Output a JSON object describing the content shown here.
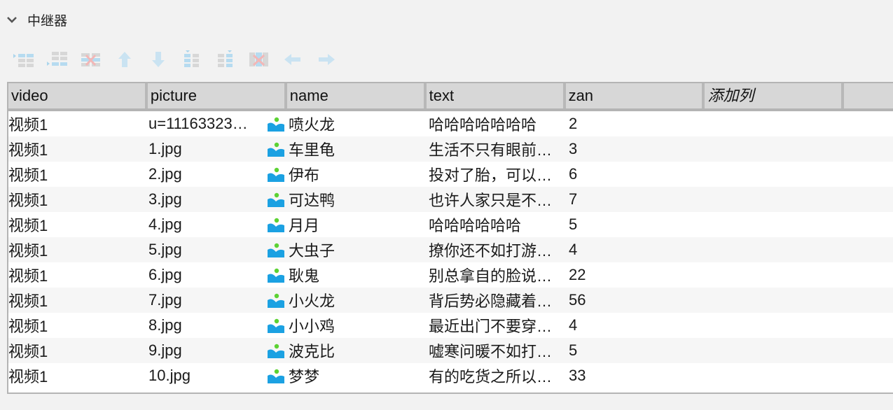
{
  "section": {
    "title": "中继器",
    "collapse_icon": "chevron-down-icon"
  },
  "toolbar": [
    {
      "name": "insert-row-above-button",
      "icon": "insert-row-above-icon"
    },
    {
      "name": "insert-row-below-button",
      "icon": "insert-row-below-icon"
    },
    {
      "name": "delete-row-button",
      "icon": "delete-row-icon"
    },
    {
      "name": "move-row-up-button",
      "icon": "arrow-up-icon"
    },
    {
      "name": "move-row-down-button",
      "icon": "arrow-down-icon"
    },
    {
      "name": "insert-column-left-button",
      "icon": "insert-column-left-icon"
    },
    {
      "name": "insert-column-right-button",
      "icon": "insert-column-right-icon"
    },
    {
      "name": "delete-column-button",
      "icon": "delete-column-icon"
    },
    {
      "name": "move-column-left-button",
      "icon": "arrow-left-icon"
    },
    {
      "name": "move-column-right-button",
      "icon": "arrow-right-icon"
    }
  ],
  "table": {
    "columns": [
      "video",
      "picture",
      "name",
      "text",
      "zan",
      "添加列",
      ""
    ],
    "rows": [
      {
        "video": "视频1",
        "picture": "u=11163323…",
        "name": "喷火龙",
        "text": "哈哈哈哈哈哈哈",
        "zan": "2"
      },
      {
        "video": "视频1",
        "picture": "1.jpg",
        "name": "车里龟",
        "text": "生活不只有眼前…",
        "zan": "3"
      },
      {
        "video": "视频1",
        "picture": "2.jpg",
        "name": "伊布",
        "text": "投对了胎，可以…",
        "zan": "6"
      },
      {
        "video": "视频1",
        "picture": "3.jpg",
        "name": "可达鸭",
        "text": "也许人家只是不…",
        "zan": "7"
      },
      {
        "video": "视频1",
        "picture": "4.jpg",
        "name": "月月",
        "text": "哈哈哈哈哈哈",
        "zan": "5"
      },
      {
        "video": "视频1",
        "picture": "5.jpg",
        "name": "大虫子",
        "text": "撩你还不如打游…",
        "zan": "4"
      },
      {
        "video": "视频1",
        "picture": "6.jpg",
        "name": "耿鬼",
        "text": "别总拿自的脸说…",
        "zan": "22"
      },
      {
        "video": "视频1",
        "picture": "7.jpg",
        "name": "小火龙",
        "text": "背后势必隐藏着…",
        "zan": "56"
      },
      {
        "video": "视频1",
        "picture": "8.jpg",
        "name": "小小鸡",
        "text": "最近出门不要穿…",
        "zan": "4"
      },
      {
        "video": "视频1",
        "picture": "9.jpg",
        "name": "波克比",
        "text": "嘘寒问暖不如打…",
        "zan": "5"
      },
      {
        "video": "视频1",
        "picture": "10.jpg",
        "name": "梦梦",
        "text": "有的吃货之所以…",
        "zan": "33"
      }
    ]
  },
  "colors": {
    "icon_blue": "#1ba1e2",
    "icon_green": "#5cd233",
    "header_bg": "#d7d7d7",
    "border": "#b4b4b4"
  }
}
